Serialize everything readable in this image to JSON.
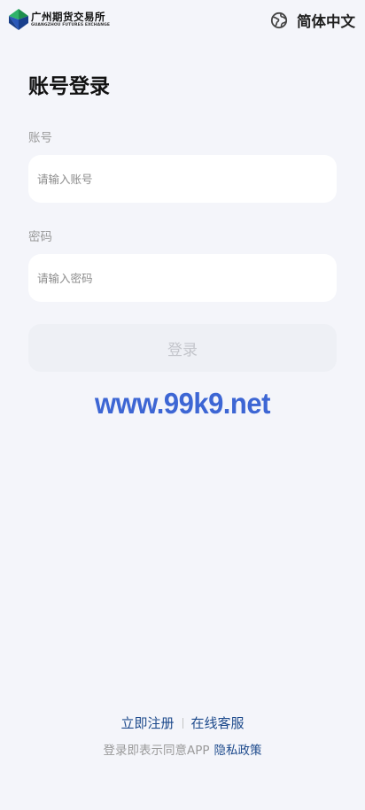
{
  "header": {
    "logo_cn": "广州期货交易所",
    "logo_en": "GUANGZHOU FUTURES EXCHANGE",
    "language_label": "简体中文",
    "language_icon": "globe-icon"
  },
  "login": {
    "title": "账号登录",
    "account_label": "账号",
    "account_placeholder": "请输入账号",
    "account_value": "",
    "password_label": "密码",
    "password_placeholder": "请输入密码",
    "password_value": "",
    "submit_label": "登录"
  },
  "watermark": "www.99k9.net",
  "footer": {
    "register_label": "立即注册",
    "service_label": "在线客服",
    "agreement_text": "登录即表示同意APP",
    "privacy_label": "隐私政策"
  },
  "colors": {
    "background": "#f4f5fa",
    "link": "#1d4a8c",
    "watermark": "#3d66d4",
    "disabled_button": "#eef0f5"
  }
}
